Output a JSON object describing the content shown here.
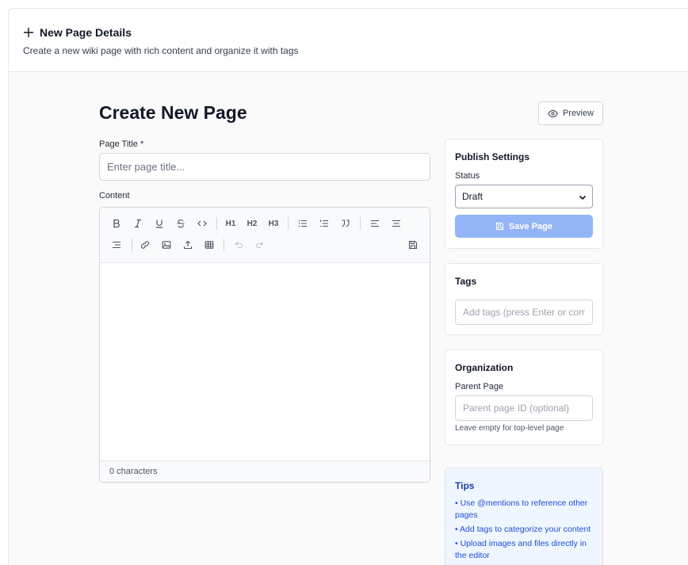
{
  "header": {
    "title": "New Page Details",
    "subtitle": "Create a new wiki page with rich content and organize it with tags"
  },
  "page": {
    "heading": "Create New Page",
    "preview_label": "Preview"
  },
  "form": {
    "title_label": "Page Title *",
    "title_placeholder": "Enter page title...",
    "content_label": "Content",
    "char_count": "0 characters"
  },
  "toolbar": {
    "items": [
      "bold",
      "italic",
      "underline",
      "strikethrough",
      "code",
      "heading-1",
      "heading-2",
      "heading-3",
      "bullet-list",
      "ordered-list",
      "blockquote",
      "align-left",
      "align-center",
      "align-right",
      "link",
      "image",
      "upload",
      "table",
      "undo",
      "redo",
      "save"
    ],
    "h1": "H1",
    "h2": "H2",
    "h3": "H3"
  },
  "publish": {
    "title": "Publish Settings",
    "status_label": "Status",
    "status_value": "Draft",
    "save_label": "Save Page"
  },
  "tags": {
    "title": "Tags",
    "placeholder": "Add tags (press Enter or com"
  },
  "organization": {
    "title": "Organization",
    "parent_label": "Parent Page",
    "parent_placeholder": "Parent page ID (optional)",
    "hint": "Leave empty for top-level page"
  },
  "tips": {
    "title": "Tips",
    "items": [
      "• Use @mentions to reference other pages",
      "• Add tags to categorize your content",
      "• Upload images and files directly in the editor"
    ]
  },
  "colors": {
    "primary_disabled": "#93b4f5",
    "tips_bg": "#eff6ff",
    "tips_text": "#1d4ed8"
  }
}
